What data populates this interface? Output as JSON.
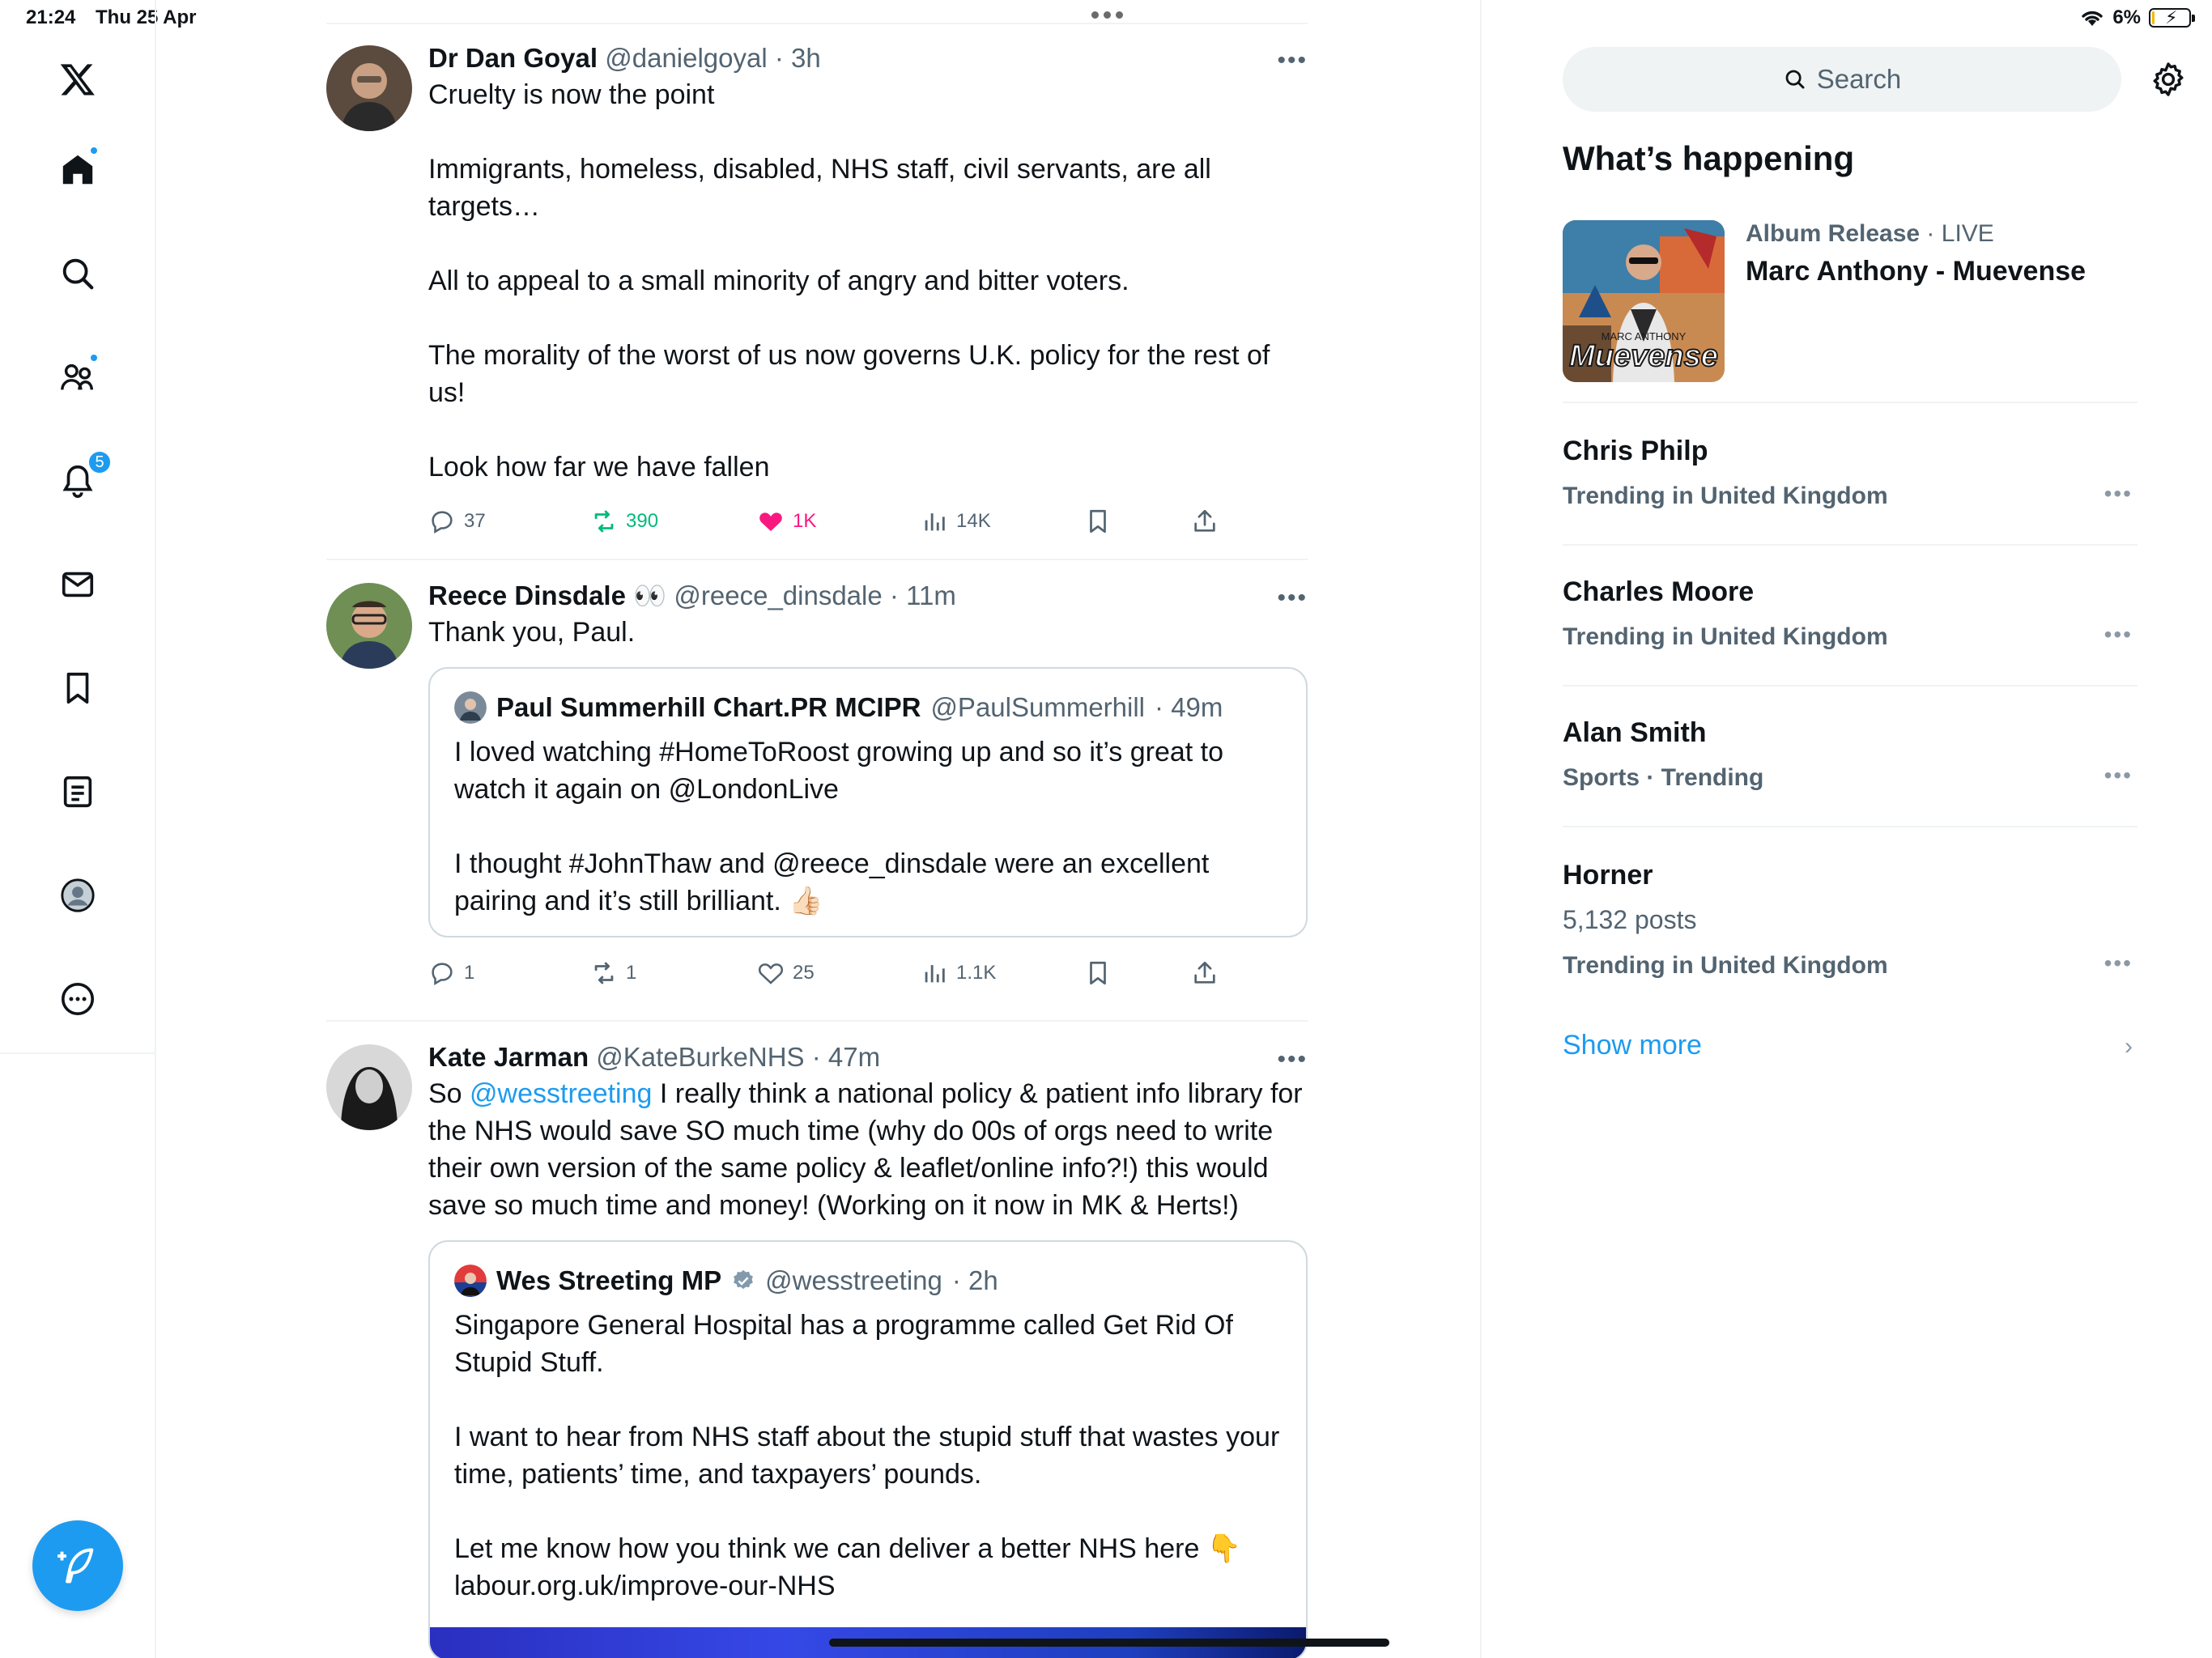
{
  "status_bar": {
    "time": "21:24",
    "date": "Thu 25 Apr",
    "battery": "6%",
    "battery_level": 0.06
  },
  "nav": {
    "items": [
      "x-logo",
      "home",
      "explore",
      "communities",
      "notifications",
      "messages",
      "bookmarks",
      "lists",
      "profile",
      "more"
    ],
    "notifications_count": "5"
  },
  "tweets": [
    {
      "name": "Dr Dan Goyal",
      "handle": "@danielgoyal",
      "time": "· 3h",
      "text": "Cruelty is now the point\n\nImmigrants, homeless, disabled, NHS staff, civil servants, are all targets…\n\nAll to appeal to a small minority of angry and bitter voters.\n\nThe morality of the worst of us now governs U.K. policy for the rest of us!\n\nLook how far we have fallen",
      "replies": "37",
      "reposts": "390",
      "likes": "1K",
      "views": "14K"
    },
    {
      "name": "Reece Dinsdale 👀",
      "handle": "@reece_dinsdale",
      "time": "· 11m",
      "text": "Thank you, Paul.",
      "quote": {
        "name": "Paul Summerhill Chart.PR MCIPR",
        "handle": "@PaulSummerhill",
        "time": "· 49m",
        "text": "I loved watching #HomeToRoost growing up and so it’s great to watch it again on @LondonLive\n\nI thought #JohnThaw and @reece_dinsdale were an excellent pairing and it’s still brilliant. 👍🏻"
      },
      "replies": "1",
      "reposts": "1",
      "likes": "25",
      "views": "1.1K"
    },
    {
      "name": "Kate Jarman",
      "handle": "@KateBurkeNHS",
      "time": "· 47m",
      "text_prefix": "So ",
      "mention": "@wesstreeting",
      "text_rest": " I really think a national policy & patient info library for the NHS would save SO much time (why do 00s of orgs need to write their own version of the same policy & leaflet/online info?!) this would save so much time and money! (Working on it now in MK & Herts!)",
      "quote": {
        "name": "Wes Streeting MP",
        "handle": "@wesstreeting",
        "time": "· 2h",
        "text": "Singapore General Hospital has a programme called Get Rid Of Stupid Stuff.\n\nI want to hear from NHS staff about the stupid stuff that wastes your time, patients’ time, and taxpayers’ pounds.\n\nLet me know how you think we can deliver a better NHS here 👇\nlabour.org.uk/improve-our-NHS"
      }
    }
  ],
  "sidebar": {
    "search_placeholder": "Search",
    "section_title": "What’s happening",
    "album": {
      "category": "Album Release",
      "live": " · LIVE",
      "title": "Marc Anthony - Muevense",
      "art_text_top": "MARC ANTHONY",
      "art_text": "Muevense"
    },
    "trends": [
      {
        "name": "Chris Philp",
        "context": "Trending in United Kingdom"
      },
      {
        "name": "Charles Moore",
        "context": "Trending in United Kingdom"
      },
      {
        "name": "Alan Smith",
        "context": "Sports · Trending"
      },
      {
        "name": "Horner",
        "posts": "5,132 posts",
        "context": "Trending in United Kingdom"
      }
    ],
    "show_more": "Show more"
  },
  "colors": {
    "accent": "#1d9bf0",
    "repost": "#00ba7c",
    "like": "#f91880",
    "muted": "#536471"
  }
}
